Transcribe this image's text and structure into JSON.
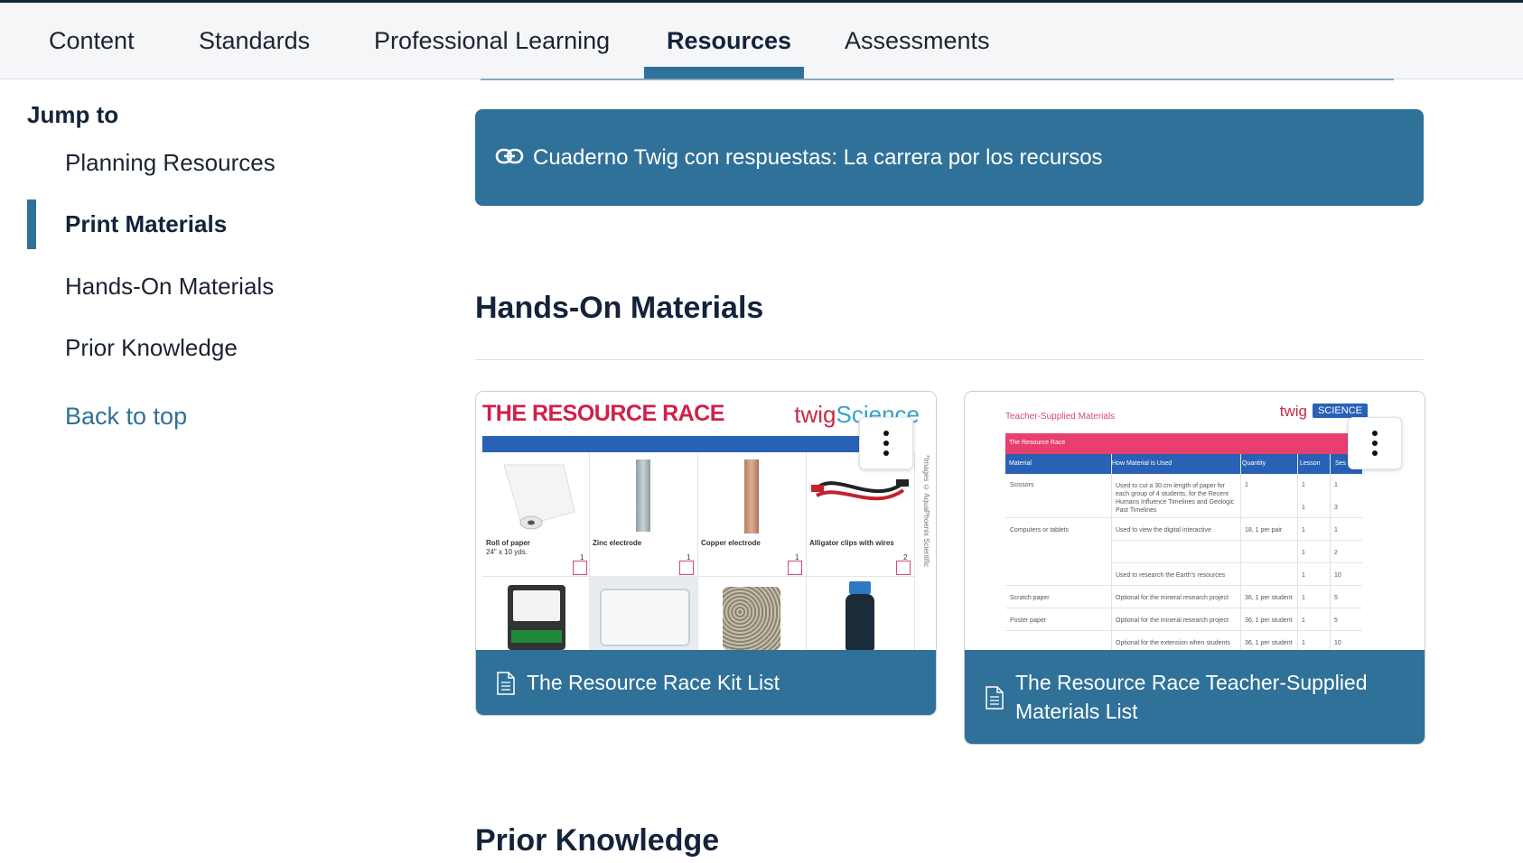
{
  "nav": {
    "tabs": [
      {
        "label": "Content"
      },
      {
        "label": "Standards"
      },
      {
        "label": "Professional Learning"
      },
      {
        "label": "Resources",
        "active": true
      },
      {
        "label": "Assessments"
      }
    ]
  },
  "sidebar": {
    "title": "Jump to",
    "items": [
      {
        "label": "Planning Resources"
      },
      {
        "label": "Print Materials",
        "active": true
      },
      {
        "label": "Hands-On Materials"
      },
      {
        "label": "Prior Knowledge"
      }
    ],
    "back_to_top": "Back to top"
  },
  "main": {
    "link_card": {
      "icon": "link-icon",
      "label": "Cuaderno Twig con respuestas: La carrera por los recursos"
    },
    "hands_on_heading": "Hands-On Materials",
    "cards": [
      {
        "caption": "The Resource Race Kit List",
        "icon": "document-icon",
        "thumb": {
          "title": "THE RESOURCE RACE",
          "brand_a": "twig",
          "brand_b": "Science",
          "side_note": "*Images © AquaPhoenix Scientific",
          "items": [
            {
              "name": "Roll of paper",
              "detail": "24\" x 10 yds.",
              "qty": "1"
            },
            {
              "name": "Zinc electrode",
              "detail": "",
              "qty": "1"
            },
            {
              "name": "Copper electrode",
              "detail": "",
              "qty": "1"
            },
            {
              "name": "Alligator clips with wires",
              "detail": "",
              "qty": "2"
            }
          ]
        }
      },
      {
        "caption": "The Resource Race Teacher-Supplied Materials List",
        "icon": "document-icon",
        "thumb": {
          "title": "Teacher-Supplied Materials",
          "brand": "twig",
          "badge": "SCIENCE",
          "subtitle": "The Resource Race",
          "headers": [
            "Material",
            "How Material is Used",
            "Quantity",
            "Lesson",
            "Ses"
          ],
          "rows": [
            {
              "material": "Scissors",
              "use": "Used to cut a 30 cm length of paper for each group of 4 students, for the Recent Humans Influence Timelines and Geologic Past Timelines",
              "qty": "1",
              "lesson": "1",
              "ses": "1"
            },
            {
              "material": "",
              "use": "",
              "qty": "",
              "lesson": "1",
              "ses": "3"
            },
            {
              "material": "Computers or tablets",
              "use": "Used to view the digital interactive",
              "qty": "18, 1 per pair",
              "lesson": "1",
              "ses": "1"
            },
            {
              "material": "",
              "use": "",
              "qty": "",
              "lesson": "1",
              "ses": "2"
            },
            {
              "material": "",
              "use": "Used to research the Earth's resources",
              "qty": "",
              "lesson": "1",
              "ses": "10"
            },
            {
              "material": "Scratch paper",
              "use": "Optional for the mineral research project",
              "qty": "36, 1 per student",
              "lesson": "1",
              "ses": "5"
            },
            {
              "material": "Poster paper",
              "use": "Optional for the mineral research project",
              "qty": "36, 1 per student",
              "lesson": "1",
              "ses": "5"
            },
            {
              "material": "",
              "use": "Optional for the extension when students",
              "qty": "36, 1 per student",
              "lesson": "1",
              "ses": "10"
            }
          ]
        }
      }
    ],
    "prior_heading": "Prior Knowledge"
  },
  "colors": {
    "accent": "#2f7199",
    "heading": "#13233a",
    "brand_red": "#d11f4a",
    "brand_blue": "#2962b5",
    "pink": "#e83f6f"
  }
}
